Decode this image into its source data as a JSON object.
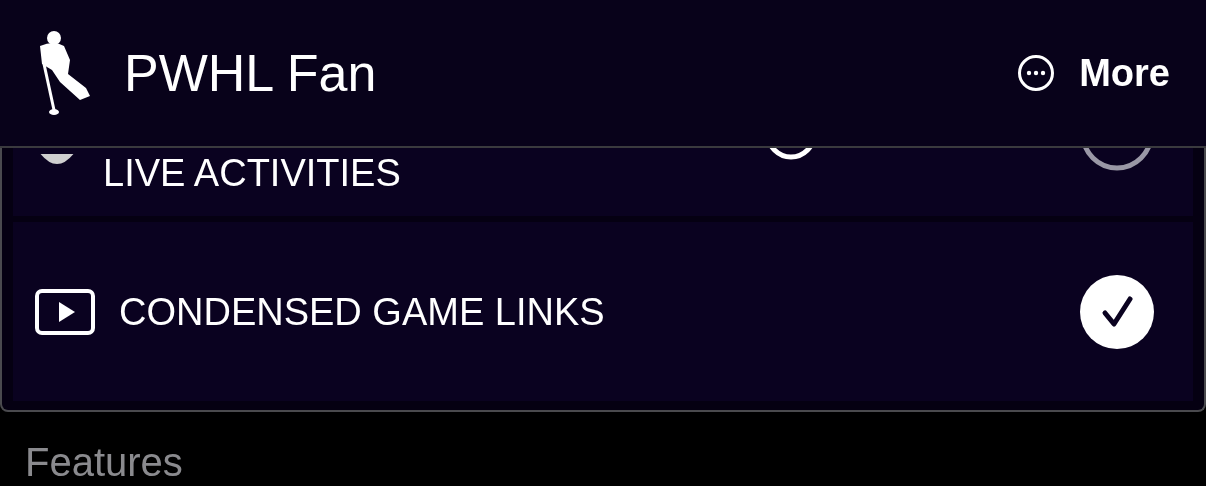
{
  "header": {
    "title": "PWHL Fan",
    "more_label": "More"
  },
  "settings": [
    {
      "kind": "activity",
      "label": "LIVE ACTIVITIES",
      "checked": false
    },
    {
      "kind": "video",
      "label": "CONDENSED GAME LINKS",
      "checked": true
    }
  ],
  "section_heading": "Features"
}
